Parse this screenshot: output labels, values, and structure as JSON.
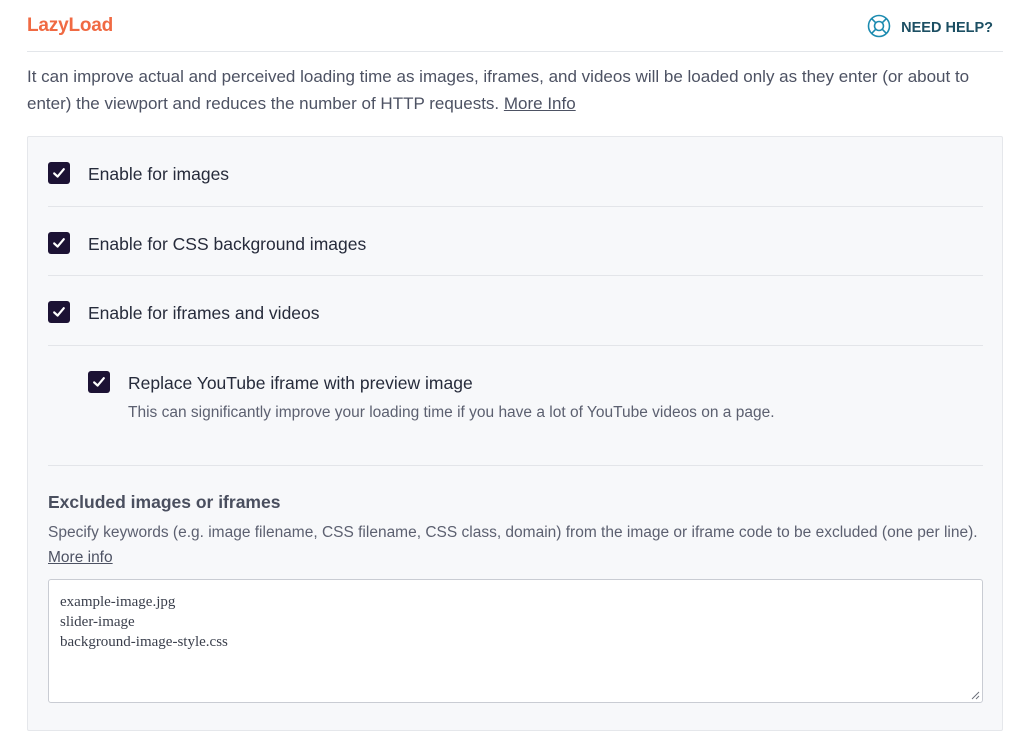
{
  "header": {
    "title": "LazyLoad",
    "help_label": "NEED HELP?"
  },
  "intro": {
    "text": "It can improve actual and perceived loading time as images, iframes, and videos will be loaded only as they enter (or about to enter) the viewport and reduces the number of HTTP requests. ",
    "link": "More Info"
  },
  "options": {
    "images": {
      "label": "Enable for images",
      "checked": true
    },
    "css_bg": {
      "label": "Enable for CSS background images",
      "checked": true
    },
    "iframes": {
      "label": "Enable for iframes and videos",
      "checked": true
    },
    "youtube": {
      "label": "Replace YouTube iframe with preview image",
      "checked": true,
      "description": "This can significantly improve your loading time if you have a lot of YouTube videos on a page."
    }
  },
  "exclusions": {
    "title": "Excluded images or iframes",
    "description": "Specify keywords (e.g. image filename, CSS filename, CSS class, domain) from the image or iframe code to be excluded (one per line). ",
    "link": "More info",
    "value": "example-image.jpg\nslider-image\nbackground-image-style.css"
  },
  "colors": {
    "accent": "#f06a43",
    "checkbox": "#1c1234",
    "help": "#1c4f63"
  },
  "icons": {
    "help": "lifebuoy-icon",
    "check": "checkmark-icon"
  }
}
